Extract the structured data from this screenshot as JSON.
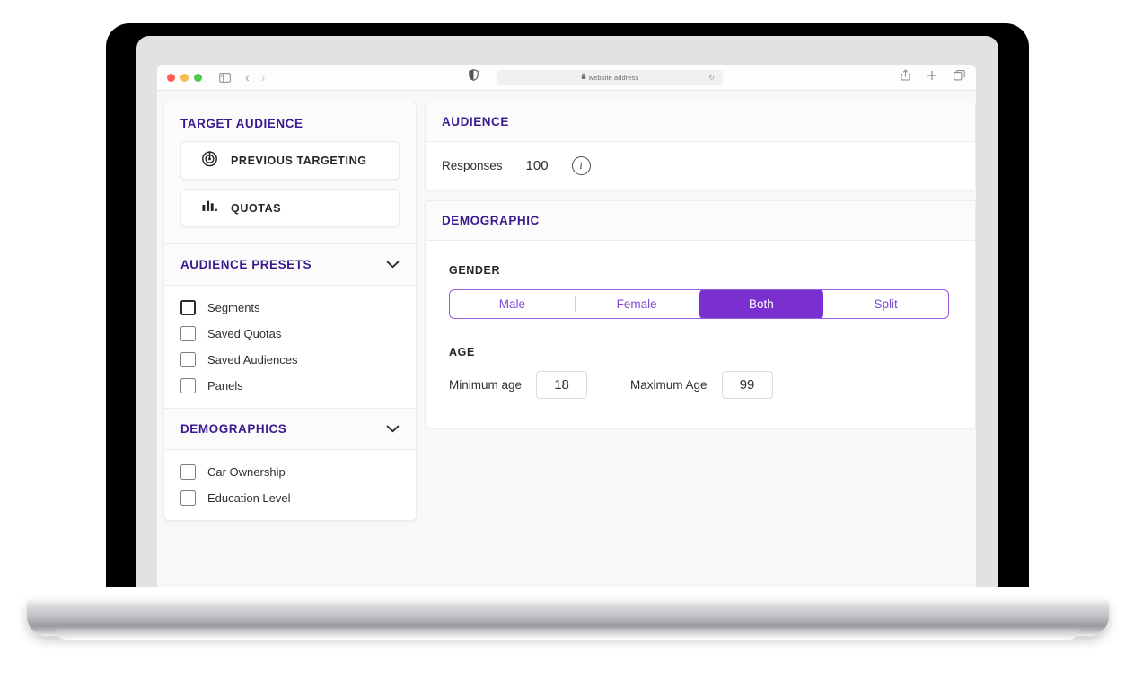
{
  "browser": {
    "address_text": "website address",
    "lock_icon": "lock-icon",
    "reload_icon": "reload-icon",
    "shield_icon": "privacy-shield-icon",
    "sidebar_toggle_icon": "sidebar-toggle-icon",
    "back_icon": "chevron-left-icon",
    "forward_icon": "chevron-right-icon",
    "share_icon": "share-icon",
    "new_tab_icon": "plus-icon",
    "tabs_icon": "tab-overview-icon"
  },
  "sidebar": {
    "title": "TARGET AUDIENCE",
    "buttons": [
      {
        "label": "PREVIOUS TARGETING",
        "icon": "target-radar-icon"
      },
      {
        "label": "QUOTAS",
        "icon": "bar-chart-icon"
      }
    ],
    "sections": [
      {
        "title": "AUDIENCE PRESETS",
        "chevron": "chevron-down-icon",
        "items": [
          {
            "label": "Segments",
            "checked": false,
            "emphasis": true
          },
          {
            "label": "Saved Quotas",
            "checked": false,
            "emphasis": false
          },
          {
            "label": "Saved Audiences",
            "checked": false,
            "emphasis": false
          },
          {
            "label": "Panels",
            "checked": false,
            "emphasis": false
          }
        ]
      },
      {
        "title": "DEMOGRAPHICS",
        "chevron": "chevron-down-icon",
        "items": [
          {
            "label": "Car Ownership",
            "checked": false,
            "emphasis": false
          },
          {
            "label": "Education Level",
            "checked": false,
            "emphasis": false
          }
        ]
      }
    ]
  },
  "main": {
    "audience_card": {
      "header": "AUDIENCE",
      "responses_label": "Responses",
      "responses_value": "100",
      "info_icon": "info-icon",
      "info_glyph": "i"
    },
    "demographic_card": {
      "header": "DEMOGRAPHIC",
      "gender": {
        "title": "GENDER",
        "options": [
          "Male",
          "Female",
          "Both",
          "Split"
        ],
        "selected": "Both"
      },
      "age": {
        "title": "AGE",
        "min_label": "Minimum age",
        "min_value": "18",
        "max_label": "Maximum Age",
        "max_value": "99"
      }
    }
  },
  "colors": {
    "heading_purple": "#3a1b8f",
    "accent_purple": "#7a2fd0",
    "segment_border": "#9b5be0",
    "segment_text": "#8248d6"
  }
}
